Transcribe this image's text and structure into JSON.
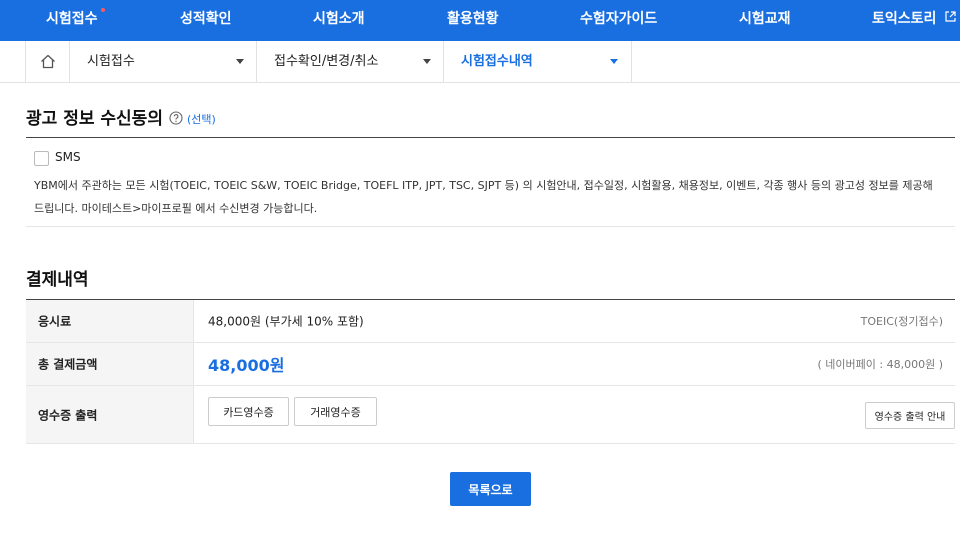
{
  "nav": {
    "items": [
      {
        "label": "시험접수",
        "new_dot": true
      },
      {
        "label": "성적확인"
      },
      {
        "label": "시험소개"
      },
      {
        "label": "활용현황"
      },
      {
        "label": "수험자가이드"
      },
      {
        "label": "시험교재"
      },
      {
        "label": "토익스토리",
        "external": true
      }
    ],
    "bg_color": "#1a6fe0"
  },
  "breadcrumb": {
    "home_icon": "home-icon",
    "items": [
      {
        "label": "시험접수"
      },
      {
        "label": "접수확인/변경/취소"
      },
      {
        "label": "시험접수내역",
        "active": true
      }
    ]
  },
  "ad_consent": {
    "title": "광고 정보 수신동의",
    "help_icon": "help-circle-icon",
    "optional_label": "(선택)",
    "sms_label": "SMS",
    "sms_checked": false,
    "description": "YBM에서 주관하는 모든 시험(TOEIC, TOEIC S&W, TOEIC Bridge, TOEFL ITP, JPT, TSC, SJPT 등) 의 시험안내, 접수일정, 시험활용, 채용정보, 이벤트, 각종 행사 등의 광고성 정보를 제공해드립니다. 마이테스트>마이프로필 에서 수신변경 가능합니다."
  },
  "payment": {
    "title": "결제내역",
    "rows": {
      "fee": {
        "label": "응시료",
        "value": "48,000원 (부가세 10% 포함)",
        "note": "TOEIC(정기접수)"
      },
      "total": {
        "label": "총 결제금액",
        "value": "48,000원",
        "note": "( 네이버페이 : 48,000원 )"
      },
      "receipt": {
        "label": "영수증 출력",
        "card_btn": "카드영수증",
        "trade_btn": "거래영수증",
        "guide_btn": "영수증 출력 안내"
      }
    }
  },
  "list_button": "목록으로",
  "colors": {
    "accent": "#1a6fe0",
    "new_dot": "#ff5a5a"
  }
}
